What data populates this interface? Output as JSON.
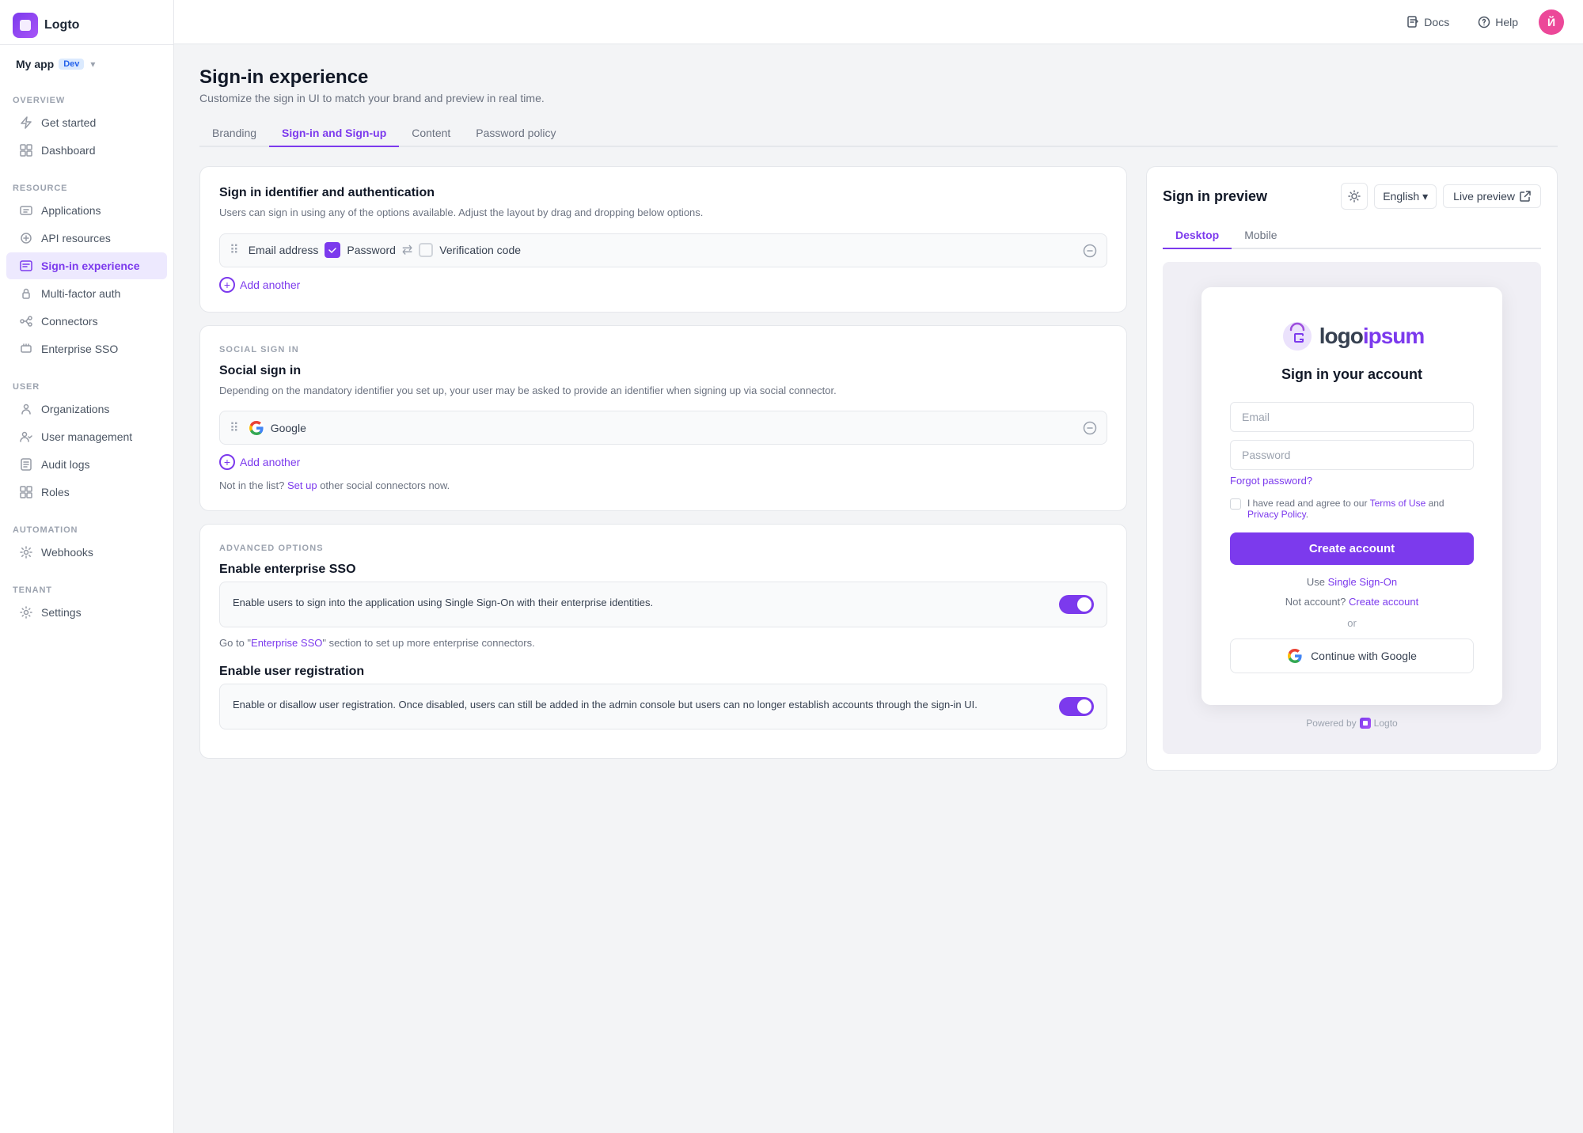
{
  "topbar": {
    "app_name": "My app",
    "dev_badge": "Dev",
    "docs_label": "Docs",
    "help_label": "Help",
    "avatar_initial": "Й"
  },
  "sidebar": {
    "logo_text": "Logto",
    "sections": [
      {
        "label": "OVERVIEW",
        "items": [
          {
            "id": "get-started",
            "label": "Get started"
          },
          {
            "id": "dashboard",
            "label": "Dashboard"
          }
        ]
      },
      {
        "label": "RESOURCE",
        "items": [
          {
            "id": "applications",
            "label": "Applications"
          },
          {
            "id": "api-resources",
            "label": "API resources"
          },
          {
            "id": "sign-in-experience",
            "label": "Sign-in experience",
            "active": true
          },
          {
            "id": "multi-factor-auth",
            "label": "Multi-factor auth"
          },
          {
            "id": "connectors",
            "label": "Connectors"
          },
          {
            "id": "enterprise-sso",
            "label": "Enterprise SSO"
          }
        ]
      },
      {
        "label": "USER",
        "items": [
          {
            "id": "organizations",
            "label": "Organizations"
          },
          {
            "id": "user-management",
            "label": "User management"
          },
          {
            "id": "audit-logs",
            "label": "Audit logs"
          },
          {
            "id": "roles",
            "label": "Roles"
          }
        ]
      },
      {
        "label": "AUTOMATION",
        "items": [
          {
            "id": "webhooks",
            "label": "Webhooks"
          }
        ]
      },
      {
        "label": "TENANT",
        "items": [
          {
            "id": "settings",
            "label": "Settings"
          }
        ]
      }
    ]
  },
  "page": {
    "title": "Sign-in experience",
    "subtitle": "Customize the sign in UI to match your brand and preview in real time.",
    "tabs": [
      {
        "id": "branding",
        "label": "Branding"
      },
      {
        "id": "sign-in-sign-up",
        "label": "Sign-in and Sign-up",
        "active": true
      },
      {
        "id": "content",
        "label": "Content"
      },
      {
        "id": "password-policy",
        "label": "Password policy"
      }
    ]
  },
  "signin_identifier": {
    "section_title": "Sign in identifier and authentication",
    "section_subtitle": "Users can sign in using any of the options available. Adjust the layout by drag and dropping below options.",
    "identifier": {
      "label": "Email address",
      "auth_method": "Password",
      "alt_method": "Verification code"
    },
    "add_another_label": "Add another"
  },
  "social_signin": {
    "section_label": "SOCIAL SIGN IN",
    "title": "Social sign in",
    "subtitle": "Depending on the mandatory identifier you set up, your user may be asked to provide an identifier when signing up via social connector.",
    "connectors": [
      {
        "id": "google",
        "name": "Google"
      }
    ],
    "add_another_label": "Add another",
    "not_in_list_text": "Not in the list?",
    "setup_label": "Set up",
    "not_in_list_suffix": "other social connectors now."
  },
  "advanced_options": {
    "section_label": "ADVANCED OPTIONS",
    "enterprise_sso": {
      "title": "Enable enterprise SSO",
      "description": "Enable users to sign into the application using Single Sign-On with their enterprise identities.",
      "enabled": true,
      "footer": "Go to \"Enterprise SSO\" section to set up more enterprise connectors.",
      "footer_link": "Enterprise SSO"
    },
    "user_registration": {
      "title": "Enable user registration",
      "description": "Enable or disallow user registration. Once disabled, users can still be added in the admin console but users can no longer establish accounts through the sign-in UI.",
      "enabled": true
    }
  },
  "preview": {
    "title": "Sign in preview",
    "language": "English",
    "live_preview_label": "Live preview",
    "tabs": [
      {
        "id": "desktop",
        "label": "Desktop",
        "active": true
      },
      {
        "id": "mobile",
        "label": "Mobile"
      }
    ],
    "signin_card": {
      "logo_text_logo": "logo",
      "logo_text_ipsum": "ipsum",
      "heading": "Sign in your account",
      "email_placeholder": "Email",
      "password_placeholder": "Password",
      "forgot_password": "Forgot password?",
      "terms_prefix": "I have read and agree to our ",
      "terms_link": "Terms of Use",
      "terms_middle": " and ",
      "privacy_link": "Privacy Policy",
      "terms_suffix": ".",
      "create_account_btn": "Create account",
      "sso_prefix": "Use ",
      "sso_link": "Single Sign-On",
      "not_account_prefix": "Not account?",
      "not_account_link": "Create account",
      "or_label": "or",
      "google_btn": "Continue with Google",
      "powered_by": "Powered by",
      "powered_brand": "Logto"
    }
  }
}
